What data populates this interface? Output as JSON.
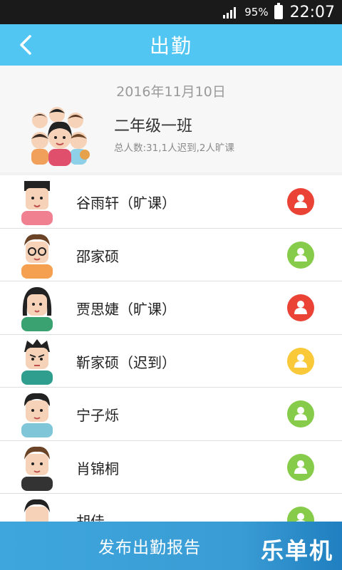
{
  "status_bar": {
    "battery_pct": "95%",
    "time": "22:07"
  },
  "header": {
    "title": "出勤"
  },
  "summary": {
    "date": "2016年11月10日",
    "class_name": "二年级一班",
    "stats": "总人数:31,1人迟到,2人旷课"
  },
  "students": [
    {
      "name": "谷雨轩（旷课）",
      "status": "absent"
    },
    {
      "name": "邵家硕",
      "status": "present"
    },
    {
      "name": "贾思婕（旷课）",
      "status": "absent"
    },
    {
      "name": "靳家硕（迟到）",
      "status": "late"
    },
    {
      "name": "宁子烁",
      "status": "present"
    },
    {
      "name": "肖锦桐",
      "status": "present"
    },
    {
      "name": "胡佳",
      "status": "present"
    }
  ],
  "status_colors": {
    "absent": "#ea4335",
    "present": "#86cc4a",
    "late": "#f9c93a"
  },
  "footer": {
    "publish_label": "发布出勤报告"
  },
  "watermark": "乐单机"
}
